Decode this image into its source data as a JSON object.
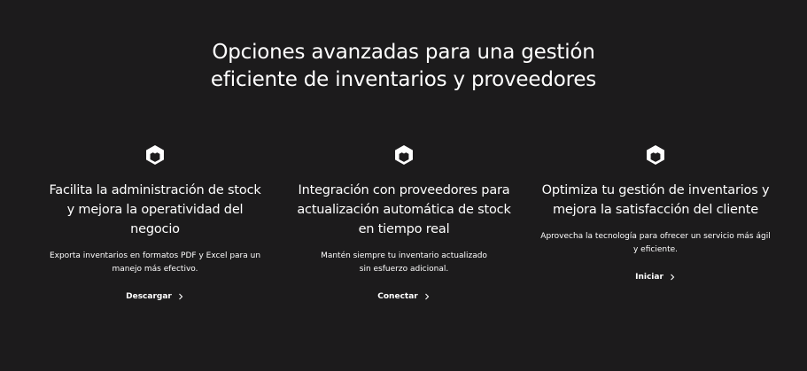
{
  "heading": {
    "line1": "Opciones avanzadas para una gestión",
    "line2": "eficiente de inventarios y proveedores"
  },
  "features": [
    {
      "icon": "cube-icon",
      "title": "Facilita la administración de stock y mejora la operatividad del negocio",
      "description": "Exporta inventarios en formatos PDF y Excel para un manejo más efectivo.",
      "link_label": "Descargar"
    },
    {
      "icon": "cube-icon",
      "title": "Integración con proveedores para actualización automática de stock en tiempo real",
      "description": "Mantén siempre tu inventario actualizado sin esfuerzo adicional.",
      "link_label": "Conectar"
    },
    {
      "icon": "cube-icon",
      "title": "Optimiza tu gestión de inventarios y mejora la satisfacción del cliente",
      "description": "Aprovecha la tecnología para ofrecer un servicio más ágil y eficiente.",
      "link_label": "Iniciar"
    }
  ],
  "colors": {
    "background": "#1c1b1c",
    "text": "#ffffff"
  }
}
